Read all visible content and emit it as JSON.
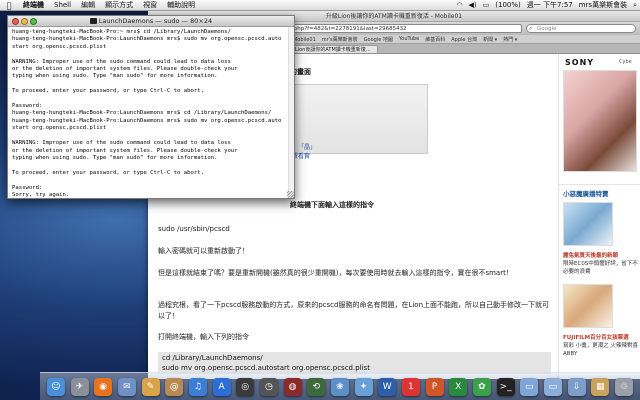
{
  "menubar": {
    "apple": "",
    "items": [
      "終端機",
      "Shell",
      "編輯",
      "顯示方式",
      "視窗",
      "輔助說明"
    ],
    "battery": "(100%)",
    "clock": "週一 下午7:57",
    "user": "mrs萬樂斯會裝"
  },
  "browser": {
    "title": "升級Lion後讓你的ATM讀卡機重新復活 - Mobile01",
    "url": "topicdetail.php?f=482&t=2278191&last=29685432",
    "search_placeholder": "Google",
    "bookmarks": [
      "拍攝翔程 - Mobile01",
      "mr's萬樂斯會裝",
      "Google 地圖",
      "YouTube",
      "維基百科",
      "Apple 台灣",
      "新聞 ▾",
      "熱門 ▾"
    ],
    "tab_active": "升級Lion後讓你的ATM讀卡機重新復..."
  },
  "article": {
    "heading_tail": "出現這樣的畫面",
    "step_text": "終端機下面輸入這樣的指令",
    "cmd1": "sudo /usr/sbin/pcscd",
    "p1": "輸入密碼就可以重新啟動了！",
    "p2": "但是這樣就結束了嗎？要是重新開機(雖然真的很少重開機)，每次要使用時就去輸入這樣的指令，實在很不smart！",
    "p3": "過程究根，看了一下pcscd服務啟動的方式，原來的pcscd服務的命名有問題，在Lion上面不能跑，所以自己動手修改一下就可以了！",
    "p4": "打開終端機，輸入下列的指令",
    "code_line1": "cd /Library/LaunchDaemons/",
    "code_line2": "sudo mv org.opensc.pcscd.autostart org.opensc.pcscd.plist",
    "link_small": "「晶」",
    "link_small2": "圖 免費看實"
  },
  "sidebar": {
    "brand": "SONY",
    "brand_tag": "Cybe",
    "block_title": "小惡魔廣播特賣",
    "item1_title": "麗兔氣質天後最的新穎",
    "item1_desc": "限時EC0S中頭體好評，省下不必要的浪費",
    "item2_title": "FUJIFILM百分百女孩票選",
    "item2_desc": "寫彩 小畫，更潮之 火辣辣對喜ABBY"
  },
  "terminal": {
    "title": "LaunchDaemons — sudo — 80×24",
    "lines": [
      "huang-teng-hungteki-MacBook-Pro:~ mrs$ cd /Library/LaunchDaemons/",
      "huang-teng-hungteki-MacBook-Pro:LaunchDaemons mrs$ sudo mv org.opensc.pcscd.auto",
      "start org.opensc.pcscd.plist",
      "",
      "WARNING: Improper use of the sudo command could lead to data loss",
      "or the deletion of important system files. Please double-check your",
      "typing when using sudo. Type \"man sudo\" for more information.",
      "",
      "To proceed, enter your password, or type Ctrl-C to abort.",
      "",
      "Password:",
      "huang-teng-hungteki-MacBook-Pro:LaunchDaemons mrs$ cd /Library/LaunchDaemons/",
      "huang-teng-hungteki-MacBook-Pro:LaunchDaemons mrs$ sudo mv org.opensc.pcscd.auto",
      "start org.opensc.pcscd.plist",
      "",
      "WARNING: Improper use of the sudo command could lead to data loss",
      "or the deletion of important system files. Please double-check your",
      "typing when using sudo. Type \"man sudo\" for more information.",
      "",
      "To proceed, enter your password, or type Ctrl-C to abort.",
      "",
      "Password:",
      "Sorry, try again.",
      "Password:"
    ]
  },
  "dock": {
    "icons": [
      {
        "name": "finder-icon",
        "glyph": "☺",
        "color": "#4a90d9"
      },
      {
        "name": "launchpad-icon",
        "glyph": "✈",
        "color": "#8a8f98"
      },
      {
        "name": "firefox-icon",
        "glyph": "◉",
        "color": "#e8731f"
      },
      {
        "name": "mail-icon",
        "glyph": "✉",
        "color": "#6e90c4"
      },
      {
        "name": "notes-icon",
        "glyph": "✎",
        "color": "#d8a34a"
      },
      {
        "name": "address-book-icon",
        "glyph": "@",
        "color": "#b78a55"
      },
      {
        "name": "itunes-icon",
        "glyph": "♫",
        "color": "#3b7fd4"
      },
      {
        "name": "app-store-icon",
        "glyph": "A",
        "color": "#2b6fd6"
      },
      {
        "name": "facetime-icon",
        "glyph": "◎",
        "color": "#3a3a3a"
      },
      {
        "name": "dashboard-icon",
        "glyph": "◷",
        "color": "#555"
      },
      {
        "name": "photo-booth-icon",
        "glyph": "◍",
        "color": "#8b2a2a"
      },
      {
        "name": "time-machine-icon",
        "glyph": "⟲",
        "color": "#3d6a3a"
      },
      {
        "name": "iphoto-icon",
        "glyph": "❀",
        "color": "#5b8fc7"
      },
      {
        "name": "network-icon",
        "glyph": "✦",
        "color": "#6aa0d8"
      },
      {
        "name": "word-icon",
        "glyph": "W",
        "color": "#2c5fa8"
      },
      {
        "name": "calendar-icon",
        "glyph": "1",
        "color": "#d33"
      },
      {
        "name": "powerpoint-icon",
        "glyph": "P",
        "color": "#d0562a"
      },
      {
        "name": "excel-icon",
        "glyph": "X",
        "color": "#2a8a3c"
      },
      {
        "name": "messenger-icon",
        "glyph": "✿",
        "color": "#3aa04a"
      },
      {
        "name": "terminal-icon",
        "glyph": ">_",
        "color": "#222"
      },
      {
        "name": "folder-icon",
        "glyph": "▭",
        "color": "#7fa6d6"
      },
      {
        "name": "documents-icon",
        "glyph": "▭",
        "color": "#8aaed9"
      },
      {
        "name": "downloads-icon",
        "glyph": "⇩",
        "color": "#7d9ecb"
      },
      {
        "name": "package-icon",
        "glyph": "▦",
        "color": "#c9a25b"
      },
      {
        "name": "trash-icon",
        "glyph": "♲",
        "color": "#9aa0a8"
      }
    ]
  }
}
